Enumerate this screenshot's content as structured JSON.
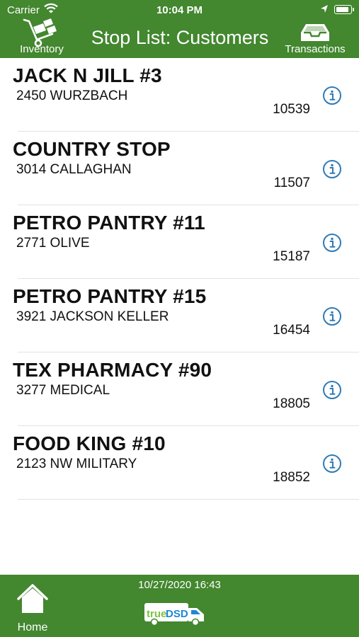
{
  "status_bar": {
    "carrier": "Carrier",
    "time": "10:04 PM",
    "battery_level": 0.9
  },
  "nav": {
    "title": "Stop List: Customers",
    "left_label": "Inventory",
    "right_label": "Transactions"
  },
  "customers": [
    {
      "name": "JACK N JILL #3",
      "address": "2450 WURZBACH",
      "number": "10539"
    },
    {
      "name": "COUNTRY STOP",
      "address": "3014 CALLAGHAN",
      "number": "11507"
    },
    {
      "name": "PETRO PANTRY #11",
      "address": "2771 OLIVE",
      "number": "15187"
    },
    {
      "name": "PETRO PANTRY #15",
      "address": "3921 JACKSON KELLER",
      "number": "16454"
    },
    {
      "name": "TEX PHARMACY #90",
      "address": "3277 MEDICAL",
      "number": "18805"
    },
    {
      "name": "FOOD KING #10",
      "address": "2123 NW MILITARY",
      "number": "18852"
    }
  ],
  "bottom_bar": {
    "home_label": "Home",
    "timestamp": "10/27/2020 16:43",
    "logo_text_1": "true",
    "logo_text_2": "DSD"
  },
  "colors": {
    "bar_green": "#43872f",
    "info_blue": "#2f7bb5",
    "logo_blue": "#1e88d6",
    "logo_green": "#7cc242"
  },
  "icons": {
    "inventory": "hand-truck-icon",
    "transactions": "inbox-tray-icon",
    "info": "info-circle-icon",
    "home": "house-icon",
    "wifi": "wifi-icon",
    "location": "location-arrow-icon",
    "battery": "battery-icon"
  }
}
